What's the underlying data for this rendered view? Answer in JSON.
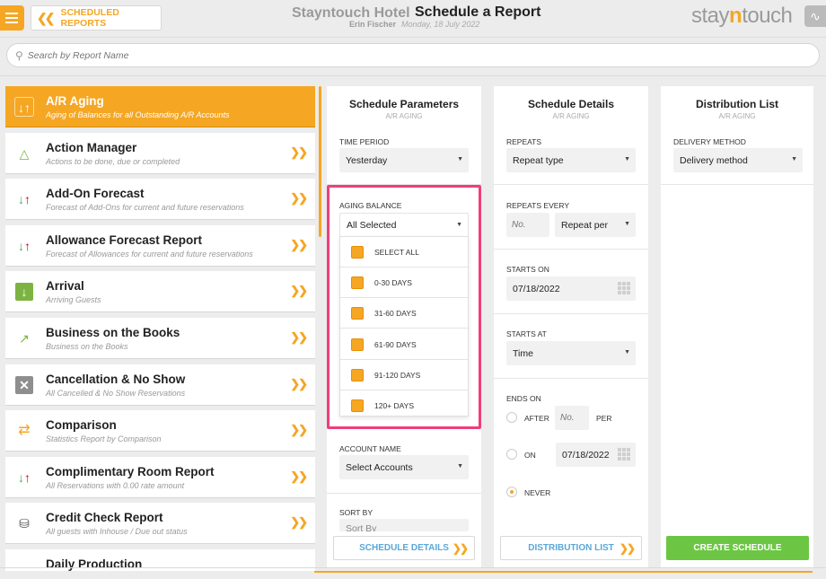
{
  "header": {
    "back_label": "SCHEDULED REPORTS",
    "hotel_name": "Stayntouch Hotel",
    "page_title": "Schedule a Report",
    "user_name": "Erin Fischer",
    "date": "Monday, 18 July 2022",
    "logo_left": "stay",
    "logo_n": "n",
    "logo_right": "touch"
  },
  "search": {
    "placeholder": "Search by Report Name"
  },
  "reports": [
    {
      "title": "A/R Aging",
      "subtitle": "Aging of Balances for all Outstanding A/R Accounts",
      "icon": "arrows-updown-icon",
      "active": true
    },
    {
      "title": "Action Manager",
      "subtitle": "Actions to be done, due or completed",
      "icon": "alert-triangle-icon"
    },
    {
      "title": "Add-On Forecast",
      "subtitle": "Forecast of Add-Ons for current and future reservations",
      "icon": "arrows-updown-icon"
    },
    {
      "title": "Allowance Forecast Report",
      "subtitle": "Forecast of Allowances for current and future reservations",
      "icon": "arrows-updown-icon"
    },
    {
      "title": "Arrival",
      "subtitle": "Arriving Guests",
      "icon": "arrival-icon"
    },
    {
      "title": "Business on the Books",
      "subtitle": "Business on the Books",
      "icon": "trend-icon"
    },
    {
      "title": "Cancellation & No Show",
      "subtitle": "All Cancelled & No Show Reservations",
      "icon": "cancel-icon"
    },
    {
      "title": "Comparison",
      "subtitle": "Statistics Report by Comparison",
      "icon": "swap-icon"
    },
    {
      "title": "Complimentary Room Report",
      "subtitle": "All Reservations with 0.00 rate amount",
      "icon": "arrows-updown-icon"
    },
    {
      "title": "Credit Check Report",
      "subtitle": "All guests with Inhouse / Due out status",
      "icon": "coins-icon"
    },
    {
      "title": "Daily Production",
      "subtitle": "",
      "icon": "production-icon"
    }
  ],
  "schedule_parameters": {
    "title": "Schedule Parameters",
    "subtitle": "A/R AGING",
    "time_period_label": "TIME PERIOD",
    "time_period_value": "Yesterday",
    "aging_balance_label": "AGING BALANCE",
    "aging_balance_value": "All Selected",
    "aging_options": [
      "SELECT ALL",
      "0-30 DAYS",
      "31-60 DAYS",
      "61-90 DAYS",
      "91-120 DAYS",
      "120+ DAYS"
    ],
    "account_name_label": "ACCOUNT NAME",
    "account_name_value": "Select Accounts",
    "sort_by_label": "SORT BY",
    "sort_by_value": "Sort By",
    "next_button": "SCHEDULE DETAILS"
  },
  "schedule_details": {
    "title": "Schedule Details",
    "subtitle": "A/R AGING",
    "repeats_label": "REPEATS",
    "repeats_value": "Repeat type",
    "repeats_every_label": "REPEATS EVERY",
    "repeats_every_placeholder": "No.",
    "repeat_per_value": "Repeat per",
    "starts_on_label": "STARTS ON",
    "starts_on_value": "07/18/2022",
    "starts_at_label": "STARTS AT",
    "starts_at_value": "Time",
    "ends_on_label": "ENDS ON",
    "after_label": "AFTER",
    "after_placeholder": "No.",
    "per_label": "PER",
    "on_label": "ON",
    "on_value": "07/18/2022",
    "never_label": "NEVER",
    "next_button": "DISTRIBUTION LIST"
  },
  "distribution": {
    "title": "Distribution List",
    "subtitle": "A/R AGING",
    "delivery_label": "DELIVERY METHOD",
    "delivery_value": "Delivery method",
    "create_button": "CREATE SCHEDULE"
  },
  "colors": {
    "accent": "#f5a623",
    "highlight": "#ef3e7b",
    "create": "#6cc644",
    "link": "#5aa7d8"
  }
}
